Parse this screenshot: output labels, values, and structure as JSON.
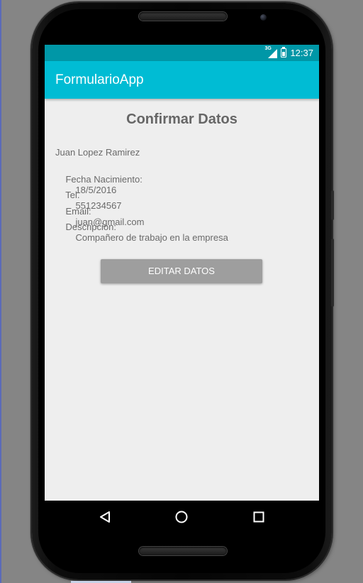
{
  "status_bar": {
    "network": "3G",
    "time": "12:37"
  },
  "app_bar": {
    "title": "FormularioApp"
  },
  "content": {
    "heading": "Confirmar Datos",
    "name": "Juan Lopez Ramirez",
    "birth_label": "Fecha Nacimiento:",
    "birth_value": "18/5/2016",
    "phone_label": "Tel.",
    "phone_value": "551234567",
    "email_label": "Email:",
    "email_value": "juan@gmail.com",
    "description_label": "Descripcion:",
    "description_value": "Compañero de trabajo en la empresa"
  },
  "actions": {
    "edit_label": "EDITAR DATOS"
  },
  "navigation": {
    "back_icon": "back-triangle-icon",
    "home_icon": "home-circle-icon",
    "recents_icon": "recents-square-icon"
  },
  "colors": {
    "status_bar": "#0097a7",
    "app_bar": "#00bcd4",
    "screen_background": "#eeeeee",
    "button": "#9e9e9e",
    "text": "#6a6a6a"
  }
}
